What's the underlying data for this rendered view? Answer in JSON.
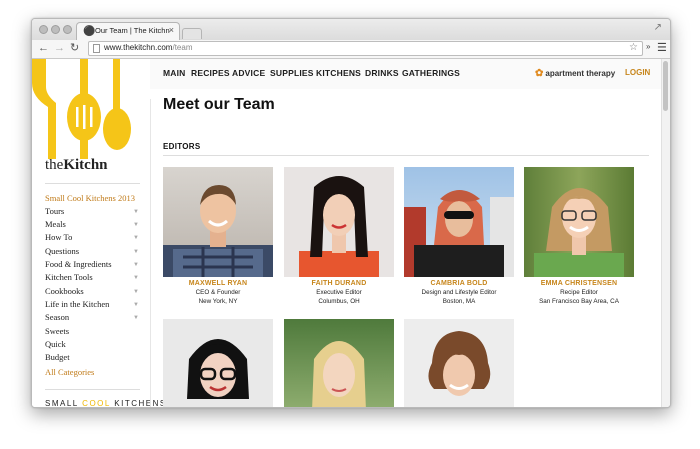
{
  "browser": {
    "tab_title": "Our Team | The Kitchn",
    "tab_close": "×",
    "url_host": "www.thekitchn.com",
    "url_path": "/team",
    "ext_label": "»"
  },
  "topnav": {
    "items": [
      "MAIN",
      "RECIPES",
      "ADVICE",
      "SUPPLIES",
      "KITCHENS",
      "DRINKS",
      "GATHERINGS"
    ],
    "brand": "apartment therapy",
    "login": "LOGIN"
  },
  "sidebar": {
    "site_name_light": "the",
    "site_name_bold": "Kitchn",
    "highlight": "Small Cool Kitchens 2013",
    "items": [
      {
        "label": "Tours",
        "arrow": true
      },
      {
        "label": "Meals",
        "arrow": true
      },
      {
        "label": "How To",
        "arrow": true
      },
      {
        "label": "Questions",
        "arrow": true
      },
      {
        "label": "Food & Ingredients",
        "arrow": true
      },
      {
        "label": "Kitchen Tools",
        "arrow": true
      },
      {
        "label": "Cookbooks",
        "arrow": true
      },
      {
        "label": "Life in the Kitchen",
        "arrow": true
      },
      {
        "label": "Season",
        "arrow": true
      },
      {
        "label": "Sweets",
        "arrow": false
      },
      {
        "label": "Quick",
        "arrow": false
      },
      {
        "label": "Budget",
        "arrow": false
      }
    ],
    "all_categories": "All Categories",
    "promo_a": "SMALL",
    "promo_b": "COOL",
    "promo_c": "KITCHENS"
  },
  "main": {
    "heading": "Meet our Team",
    "section": "EDITORS",
    "team": [
      {
        "name": "MAXWELL RYAN",
        "role": "CEO & Founder",
        "location": "New York, NY"
      },
      {
        "name": "FAITH DURAND",
        "role": "Executive Editor",
        "location": "Columbus, OH"
      },
      {
        "name": "CAMBRIA BOLD",
        "role": "Design and Lifestyle Editor",
        "location": "Boston, MA"
      },
      {
        "name": "EMMA CHRISTENSEN",
        "role": "Recipe Editor",
        "location": "San Francisco Bay Area, CA"
      },
      {
        "name": "",
        "role": "",
        "location": ""
      },
      {
        "name": "",
        "role": "",
        "location": ""
      },
      {
        "name": "",
        "role": "",
        "location": ""
      }
    ]
  },
  "colors": {
    "accent": "#c7861c",
    "logo_yellow": "#f5c518",
    "heading": "#111111"
  }
}
